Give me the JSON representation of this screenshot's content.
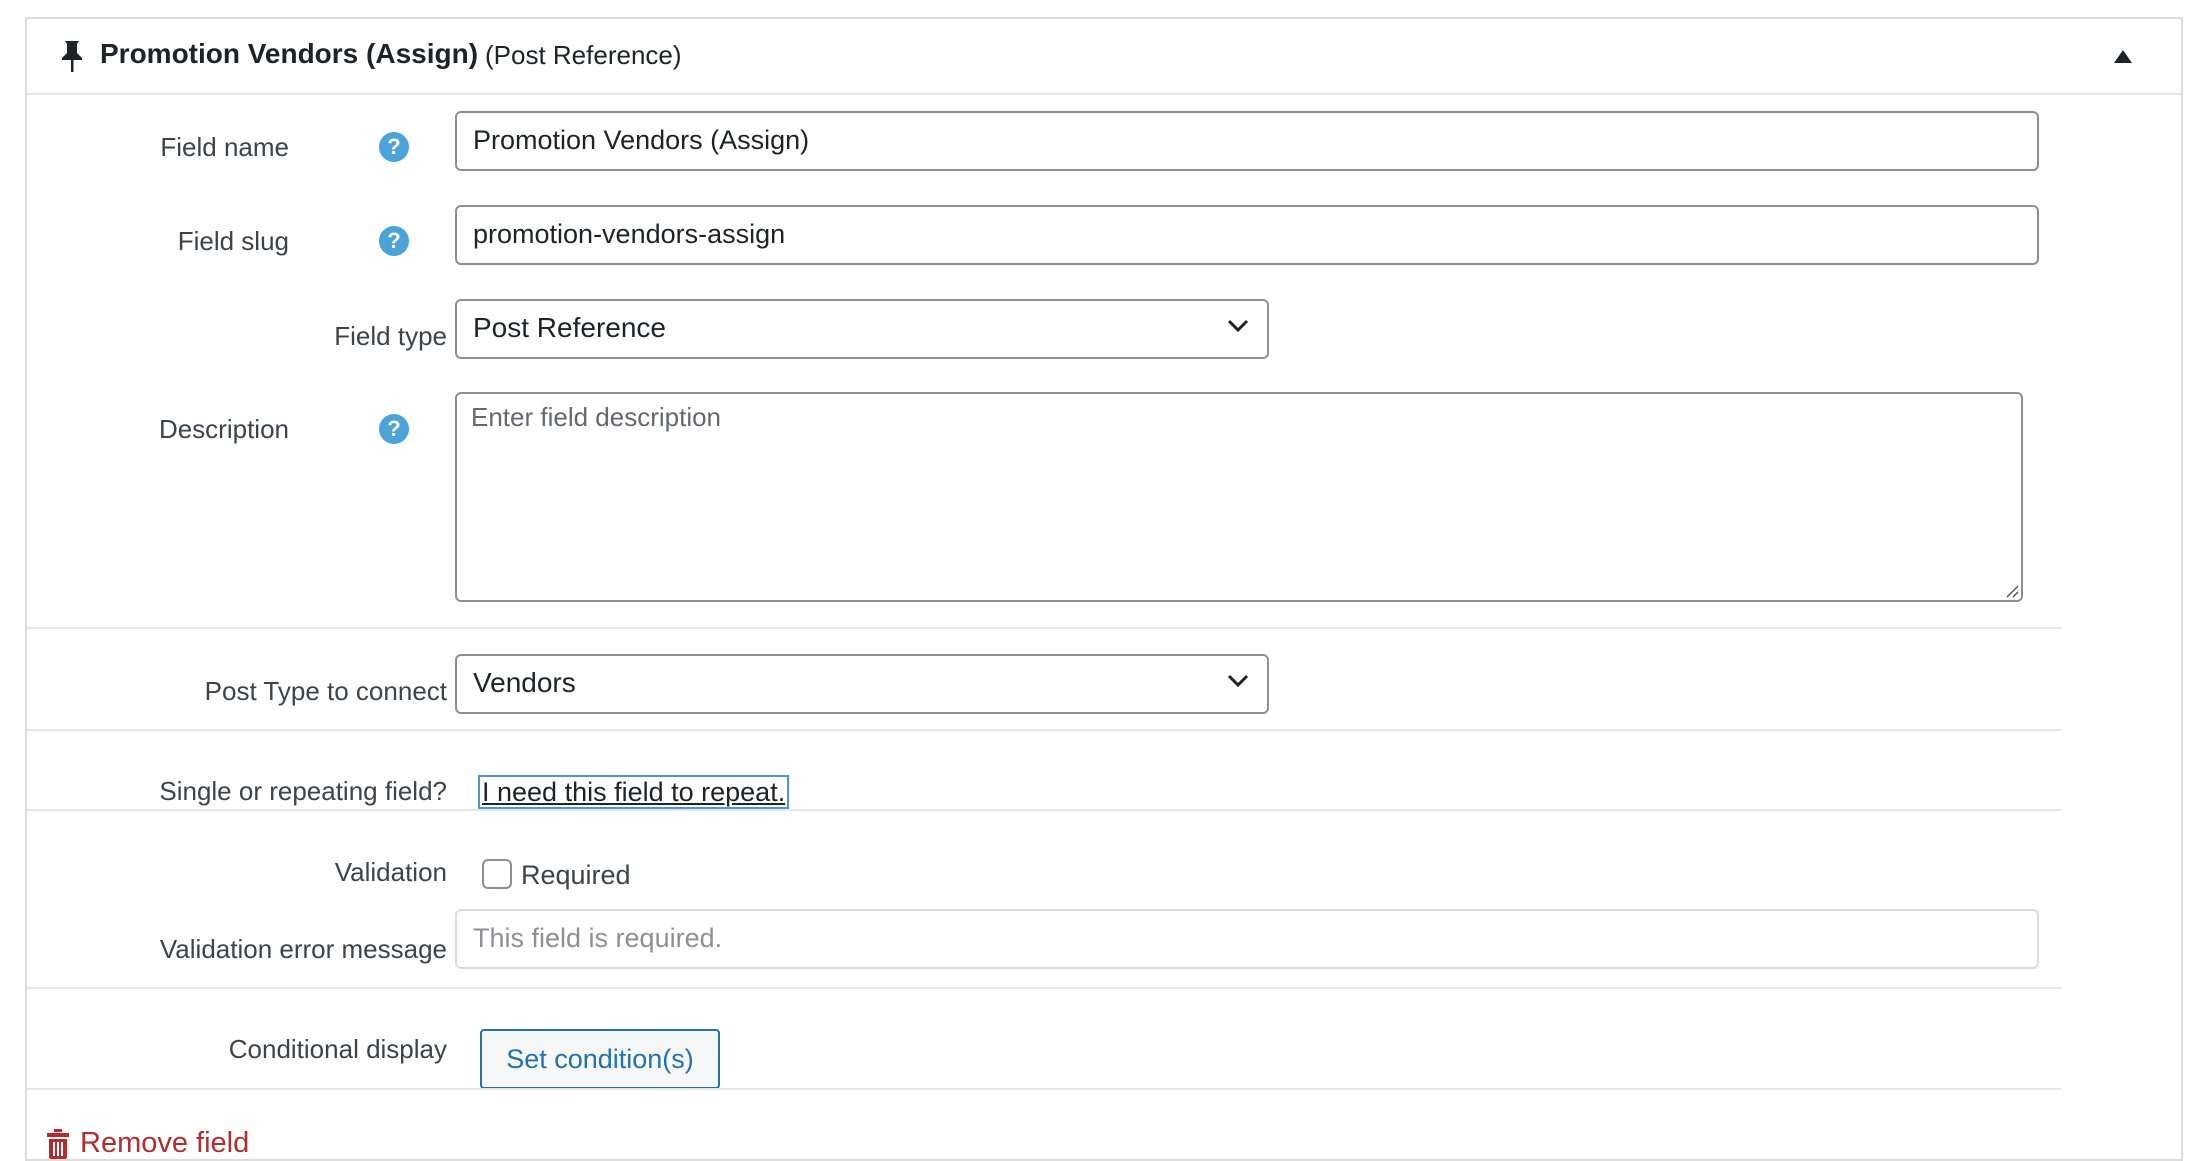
{
  "header": {
    "title": "Promotion Vendors (Assign)",
    "subtitle": "(Post Reference)",
    "icons": {
      "pin": "pin-icon",
      "collapse": "triangle-up-icon"
    }
  },
  "fields": {
    "field_name": {
      "label": "Field name",
      "value": "Promotion Vendors (Assign)",
      "help": "?"
    },
    "field_slug": {
      "label": "Field slug",
      "value": "promotion-vendors-assign",
      "help": "?"
    },
    "field_type": {
      "label": "Field type",
      "selected": "Post Reference"
    },
    "description": {
      "label": "Description",
      "placeholder": "Enter field description",
      "help": "?"
    },
    "post_type": {
      "label": "Post Type to connect",
      "selected": "Vendors"
    },
    "repeating": {
      "label": "Single or repeating field?",
      "link": "I need this field to repeat."
    },
    "validation": {
      "label": "Validation",
      "checkbox_label": "Required",
      "checked": false
    },
    "validation_error": {
      "label": "Validation error message",
      "placeholder": "This field is required."
    },
    "conditional": {
      "label": "Conditional display",
      "button": "Set condition(s)"
    }
  },
  "footer": {
    "remove_label": "Remove field",
    "icon": "trash-icon"
  },
  "colors": {
    "accent": "#2271b1",
    "help": "#4aa3d9",
    "danger": "#b32d2e",
    "border": "#8c8f94"
  }
}
